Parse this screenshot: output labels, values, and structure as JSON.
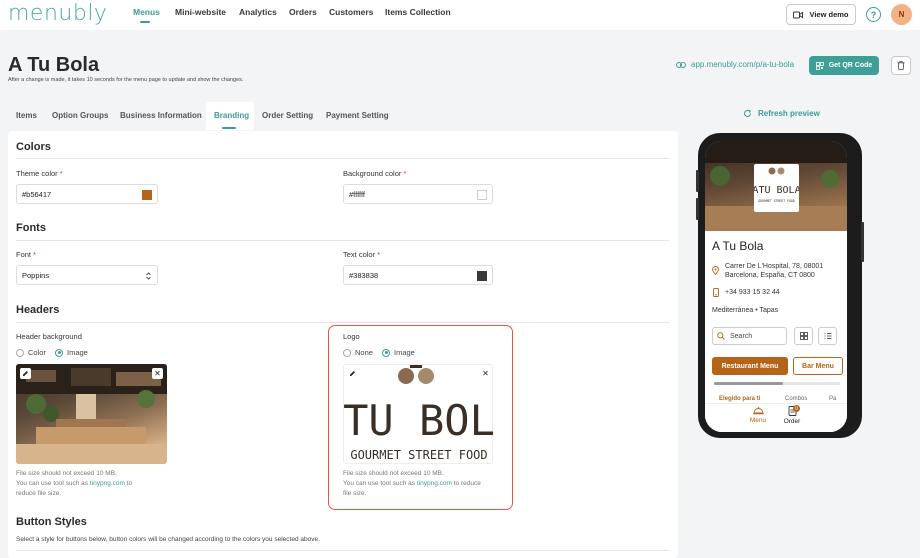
{
  "brand": {
    "logo_text": "menubly",
    "accent": "#3d9b94"
  },
  "nav": {
    "items": [
      "Menus",
      "Mini-website",
      "Analytics",
      "Orders",
      "Customers",
      "Items Collection"
    ],
    "active": "Menus",
    "view_demo": "View demo",
    "help": "?",
    "avatar": "N"
  },
  "header": {
    "title": "A Tu Bola",
    "subtitle": "After a change is made, it takes 10 seconds for the menu page to update and show the changes.",
    "link": "app.menubly.com/p/a-tu-bola",
    "qr_button": "Get QR Code"
  },
  "tabs": [
    "Items",
    "Option Groups",
    "Business Information",
    "Branding",
    "Order Setting",
    "Payment Setting"
  ],
  "active_tab": "Branding",
  "colors": {
    "title": "Colors",
    "theme_label": "Theme color",
    "theme_value": "#b56417",
    "background_label": "Background color",
    "background_value": "#ffffff"
  },
  "fonts": {
    "title": "Fonts",
    "font_label": "Font",
    "font_value": "Poppins",
    "text_color_label": "Text color",
    "text_color_value": "#383838"
  },
  "headers": {
    "title": "Headers",
    "header_bg_label": "Header background",
    "opt_color": "Color",
    "opt_image": "Image",
    "header_bg_selected": "Image",
    "logo_label": "Logo",
    "opt_none": "None",
    "logo_selected": "Image",
    "hint_line1": "File size should not exceed 10 MB.",
    "hint_line2_prefix": "You can use tool such as",
    "hint_link": "tinypng.com",
    "hint_line2_suffix": "to",
    "hint_line3": "reduce file size.",
    "hint_line2_suffix_logo": "to reduce",
    "hint_line3_logo": "file size.",
    "logo_art_line1": "ATU BOLA",
    "logo_art_line2": "GOURMET STREET FOOD"
  },
  "button_styles": {
    "title": "Button Styles",
    "description": "Select a style for buttons below, button colors will be changed according to the colors you selected above."
  },
  "preview": {
    "refresh": "Refresh preview",
    "venue": "A Tu Bola",
    "address_line1": "Carrer De L'Hospital, 78, 08001",
    "address_line2": "Barcelona, España, CT 0800",
    "phone": "+34 933 15 32 44",
    "cuisine": "Mediterránea • Tapas",
    "search": "Search",
    "btn_restaurant": "Restaurant Menu",
    "btn_bar": "Bar Menu",
    "cat1": "Elegido para ti",
    "cat2": "Combos",
    "cat3": "Pa",
    "tab_menu": "Menu",
    "tab_order": "Order",
    "order_badge": "0",
    "logo_mini_1": "ATU BOLA",
    "logo_mini_2": "GOURMET STREET FOOD",
    "scroll_progress": 0.55
  }
}
